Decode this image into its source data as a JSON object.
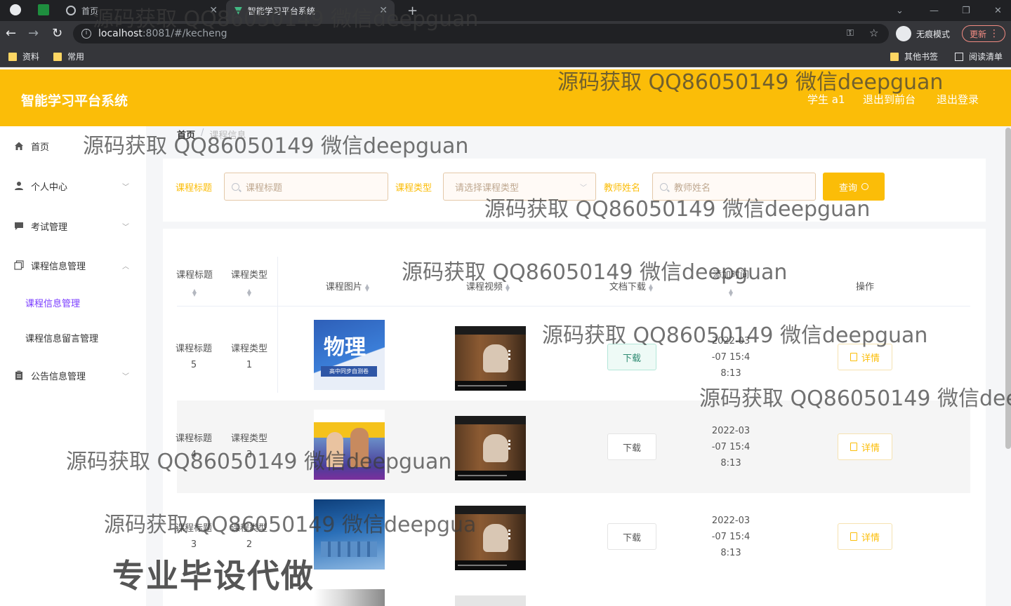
{
  "browser": {
    "tabs": [
      {
        "title": "首页"
      },
      {
        "title": "智能学习平台系统"
      }
    ],
    "url_host": "localhost",
    "url_path": ":8081/#/kecheng",
    "incognito_label": "无痕模式",
    "update_label": "更新",
    "bookmarks": [
      {
        "label": "资料"
      },
      {
        "label": "常用"
      },
      {
        "label": "其他书签"
      },
      {
        "label": "阅读清单"
      }
    ]
  },
  "header": {
    "title": "智能学习平台系统",
    "user": "学生 a1",
    "front_link": "退出到前台",
    "logout_link": "退出登录"
  },
  "sidebar": {
    "items": [
      {
        "label": "首页",
        "icon": "home-icon"
      },
      {
        "label": "个人中心",
        "icon": "user-icon"
      },
      {
        "label": "考试管理",
        "icon": "chat-icon"
      },
      {
        "label": "课程信息管理",
        "icon": "copy-icon"
      },
      {
        "label": "公告信息管理",
        "icon": "clipboard-icon"
      }
    ],
    "sub_items": [
      {
        "label": "课程信息管理",
        "active": true
      },
      {
        "label": "课程信息留言管理",
        "active": false
      }
    ]
  },
  "breadcrumb": {
    "home": "首页",
    "sep": "/",
    "current": "课程信息"
  },
  "search": {
    "title_label": "课程标题",
    "title_placeholder": "课程标题",
    "type_label": "课程类型",
    "type_placeholder": "请选择课程类型",
    "teacher_label": "教师姓名",
    "teacher_placeholder": "教师姓名",
    "query_button": "查询"
  },
  "table": {
    "columns": [
      "课程标题",
      "课程类型",
      "课程图片",
      "课程视频",
      "文档下载",
      "添加时间",
      "操作"
    ],
    "rows": [
      {
        "title_line1": "课程标题",
        "title_line2": "5",
        "type_line1": "课程类型",
        "type_line2": "1",
        "date_l1": "2022-03",
        "date_l2": "-07 15:4",
        "date_l3": "8:13",
        "download": "下载",
        "detail": "详情"
      },
      {
        "title_line1": "课程标题",
        "title_line2": "4",
        "type_line1": "课程类型",
        "type_line2": "3",
        "date_l1": "2022-03",
        "date_l2": "-07 15:4",
        "date_l3": "8:13",
        "download": "下载",
        "detail": "详情"
      },
      {
        "title_line1": "课程标题",
        "title_line2": "3",
        "type_line1": "课程类型",
        "type_line2": "2",
        "date_l1": "2022-03",
        "date_l2": "-07 15:4",
        "date_l3": "8:13",
        "download": "下载",
        "detail": "详情"
      }
    ]
  },
  "thumbnails": {
    "physics_title": "物理",
    "physics_subtitle": "高中同步自测卷"
  },
  "watermark": {
    "text": "源码获取 QQ86050149 微信deepguan",
    "text_cut": "源码获取 QQ86050149 微信dee",
    "text_cut2": "源码获取 QQ86050149 微信deepgua",
    "promo": "专业毕设代做"
  }
}
